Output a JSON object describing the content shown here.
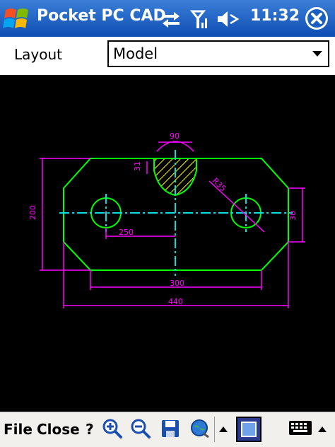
{
  "titlebar": {
    "title": "Pocket PC CAD",
    "time": "11:32"
  },
  "layout": {
    "label": "Layout",
    "selected": "Model"
  },
  "menu": {
    "file": "File",
    "close": "Close",
    "help": "?"
  },
  "drawing": {
    "dimensions": {
      "top": "90",
      "height": "200",
      "center_dist": "250",
      "bottom_inner": "300",
      "bottom_outer": "440",
      "right": "30",
      "hatch_label": "31",
      "radius_label": "R35"
    }
  },
  "colors": {
    "title_bar": "#1a5fc4",
    "outline": "#00ff00",
    "dimension": "#ff00ff",
    "centerline": "#00e0e0",
    "hatch": "#ffff00"
  }
}
